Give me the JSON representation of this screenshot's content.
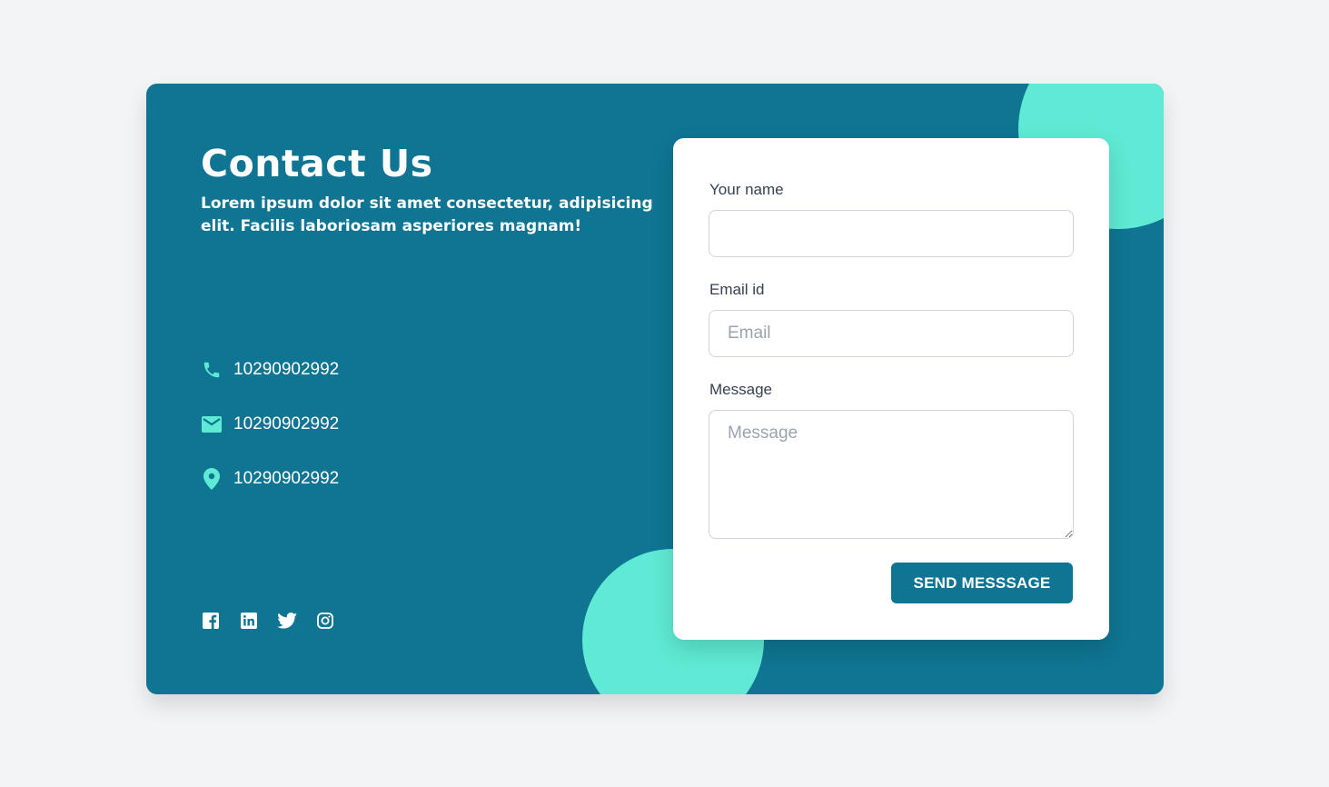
{
  "colors": {
    "background": "#f3f4f6",
    "card": "#0f7592",
    "accent": "#5eead4",
    "form_card": "#ffffff",
    "button": "#0f7592"
  },
  "header": {
    "title": "Contact Us",
    "subtitle": "Lorem ipsum dolor sit amet consectetur, adipisicing elit. Facilis laboriosam asperiores magnam!"
  },
  "contact": {
    "items": [
      {
        "icon": "phone-icon",
        "text": "10290902992"
      },
      {
        "icon": "mail-icon",
        "text": "10290902992"
      },
      {
        "icon": "location-pin-icon",
        "text": "10290902992"
      }
    ]
  },
  "social": {
    "icons": [
      "facebook-icon",
      "linkedin-icon",
      "twitter-icon",
      "instagram-icon"
    ]
  },
  "form": {
    "name_label": "Your name",
    "name_value": "",
    "name_placeholder": "",
    "email_label": "Email id",
    "email_value": "",
    "email_placeholder": "Email",
    "message_label": "Message",
    "message_value": "",
    "message_placeholder": "Message",
    "submit_label": "SEND MESSSAGE"
  }
}
